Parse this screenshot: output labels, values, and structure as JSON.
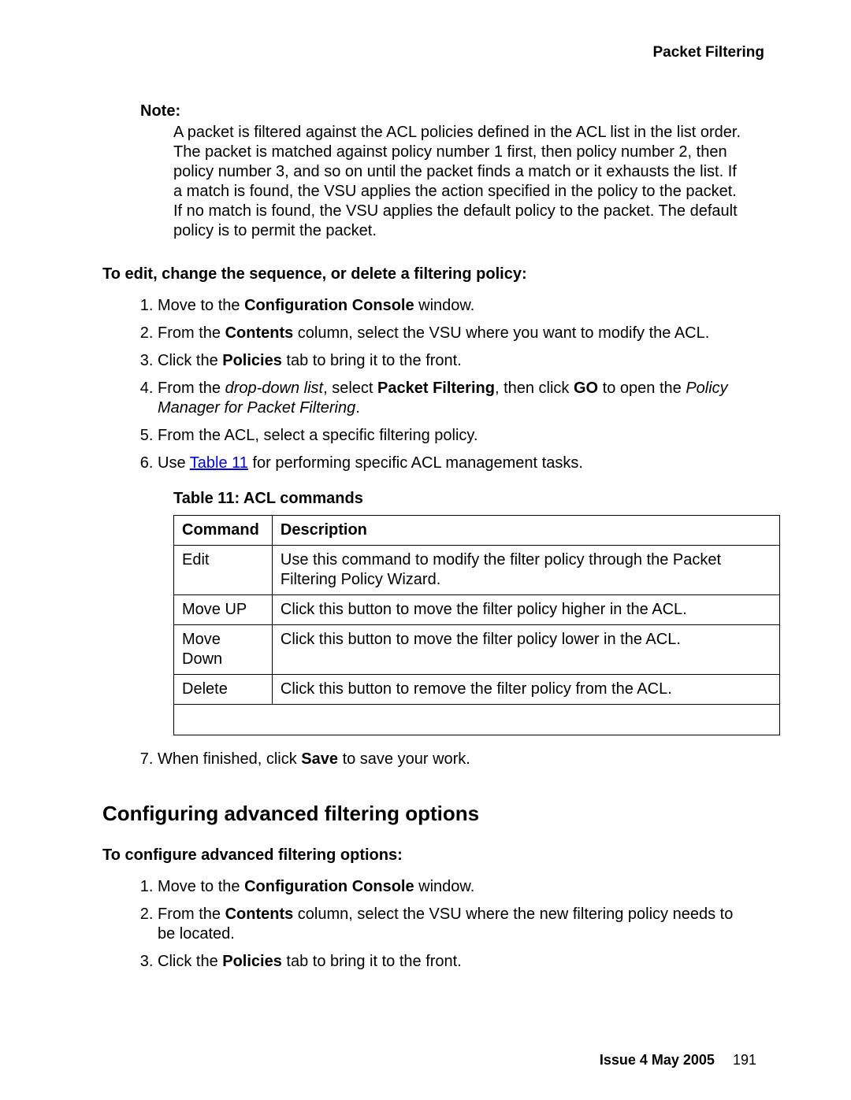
{
  "header": {
    "title": "Packet Filtering"
  },
  "note": {
    "label": "Note:",
    "text": "A packet is filtered against the ACL policies defined in the ACL list in the list order. The packet is matched against policy number 1 first, then policy number 2, then policy number 3, and so on until the packet finds a match or it exhausts the list. If a match is found, the VSU applies the action specified in the policy to the packet. If no match is found, the VSU applies the default policy to the packet. The default policy is to permit the packet."
  },
  "section1": {
    "heading": "To edit, change the sequence, or delete a filtering policy:",
    "steps": {
      "s1a": "Move to the ",
      "s1b": "Configuration Console",
      "s1c": " window.",
      "s2a": "From the ",
      "s2b": "Contents",
      "s2c": " column, select the VSU where you want to modify the ACL.",
      "s3a": "Click the ",
      "s3b": "Policies",
      "s3c": " tab to bring it to the front.",
      "s4a": "From the ",
      "s4b": "drop-down list",
      "s4c": ", select ",
      "s4d": "Packet Filtering",
      "s4e": ", then click ",
      "s4f": "GO",
      "s4g": " to open the ",
      "s4h": "Policy Manager for Packet Filtering",
      "s4i": ".",
      "s5": "From the ACL, select a specific filtering policy.",
      "s6a": "Use ",
      "s6b": "Table 11",
      "s6c": " for performing specific ACL management tasks.",
      "s7a": "When finished, click ",
      "s7b": "Save",
      "s7c": " to save your work."
    }
  },
  "table": {
    "caption": "Table 11: ACL commands",
    "headers": {
      "c1": "Command",
      "c2": "Description"
    },
    "rows": [
      {
        "cmd": "Edit",
        "desc": "Use this command to modify the filter policy through the Packet Filtering Policy Wizard."
      },
      {
        "cmd": "Move UP",
        "desc": "Click this button to move the filter policy higher in the ACL."
      },
      {
        "cmd": "Move Down",
        "desc": "Click this button to move the filter policy lower in the ACL."
      },
      {
        "cmd": "Delete",
        "desc": "Click this button to remove the filter policy from the ACL."
      }
    ]
  },
  "section2": {
    "big_heading": "Configuring advanced filtering options",
    "heading": "To configure advanced filtering options:",
    "steps": {
      "s1a": "Move to the ",
      "s1b": "Configuration Console",
      "s1c": " window.",
      "s2a": "From the ",
      "s2b": "Contents",
      "s2c": " column, select the VSU where the new filtering policy needs to be located.",
      "s3a": "Click the ",
      "s3b": "Policies",
      "s3c": " tab to bring it to the front."
    }
  },
  "footer": {
    "issue": "Issue 4   May 2005",
    "page": "191"
  }
}
